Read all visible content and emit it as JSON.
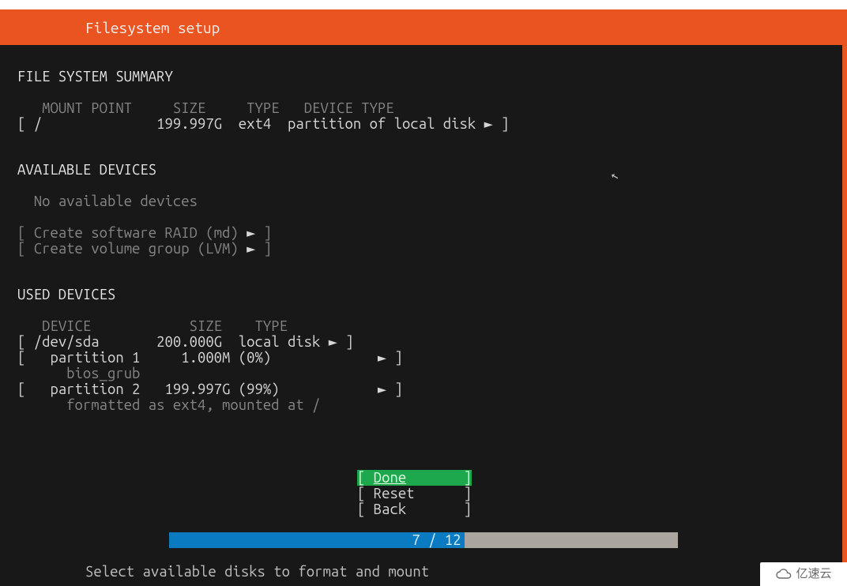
{
  "header": {
    "title": "Filesystem setup"
  },
  "fs_summary": {
    "heading": "FILE SYSTEM SUMMARY",
    "cols": {
      "mount": "MOUNT POINT",
      "size": "SIZE",
      "type": "TYPE",
      "dtype": "DEVICE TYPE"
    },
    "row": {
      "mount": "/",
      "size": "199.997G",
      "type": "ext4",
      "dtype": "partition of local disk"
    }
  },
  "available": {
    "heading": "AVAILABLE DEVICES",
    "none": "No available devices",
    "raid": "Create software RAID (md)",
    "lvm": "Create volume group (LVM)"
  },
  "used": {
    "heading": "USED DEVICES",
    "cols": {
      "device": "DEVICE",
      "size": "SIZE",
      "type": "TYPE"
    },
    "disk": {
      "name": "/dev/sda",
      "size": "200.000G",
      "type": "local disk"
    },
    "part1": {
      "name": "partition 1",
      "size": "1.000M",
      "pct": "(0%)",
      "desc": "bios_grub"
    },
    "part2": {
      "name": "partition 2",
      "size": "199.997G",
      "pct": "(99%)",
      "desc": "formatted as ext4, mounted at /"
    }
  },
  "buttons": {
    "done": "Done",
    "reset": "Reset",
    "back": "Back"
  },
  "progress": {
    "text": "7 / 12",
    "percent": 58
  },
  "help": "Select available disks to format and mount",
  "watermark": "亿速云"
}
